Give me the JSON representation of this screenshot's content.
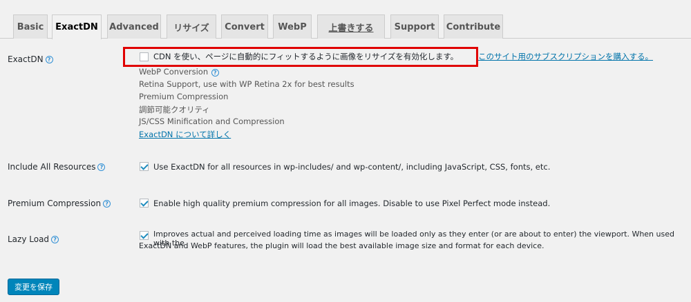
{
  "tabs": [
    {
      "label": "Basic",
      "active": false
    },
    {
      "label": "ExactDN",
      "active": true
    },
    {
      "label": "Advanced",
      "active": false
    },
    {
      "label": "リサイズ",
      "active": false
    },
    {
      "label": "Convert",
      "active": false
    },
    {
      "label": "WebP",
      "active": false
    },
    {
      "label": "上書きする",
      "active": false
    },
    {
      "label": "Support",
      "active": false
    },
    {
      "label": "Contribute",
      "active": false
    }
  ],
  "exactdn": {
    "label": "ExactDN",
    "checkbox_text": "CDN を使い、ページに自動的にフィットするように画像をリサイズを有効化します。",
    "checked": false,
    "subscribe_link": "このサイト用のサブスクリプションを購入する。",
    "features": [
      "WebP Conversion",
      "Retina Support, use with WP Retina 2x for best results",
      "Premium Compression",
      "調節可能クオリティ",
      "JS/CSS Minification and Compression"
    ],
    "learn_more_link": "ExactDN について詳しく"
  },
  "include_all": {
    "label": "Include All Resources",
    "text": "Use ExactDN for all resources in wp-includes/ and wp-content/, including JavaScript, CSS, fonts, etc.",
    "checked": true
  },
  "premium": {
    "label": "Premium Compression",
    "text": "Enable high quality premium compression for all images. Disable to use Pixel Perfect mode instead.",
    "checked": true
  },
  "lazy": {
    "label": "Lazy Load",
    "text_line1": "Improves actual and perceived loading time as images will be loaded only as they enter (or are about to enter) the viewport. When used with the",
    "text_line2": "ExactDN and WebP features, the plugin will load the best available image size and format for each device.",
    "checked": true
  },
  "help_glyph": "?",
  "save_button": "変更を保存",
  "colors": {
    "highlight": "#e00000",
    "link": "#0073aa",
    "primary_button": "#0085ba",
    "help_icon": "#2f8fd5"
  }
}
